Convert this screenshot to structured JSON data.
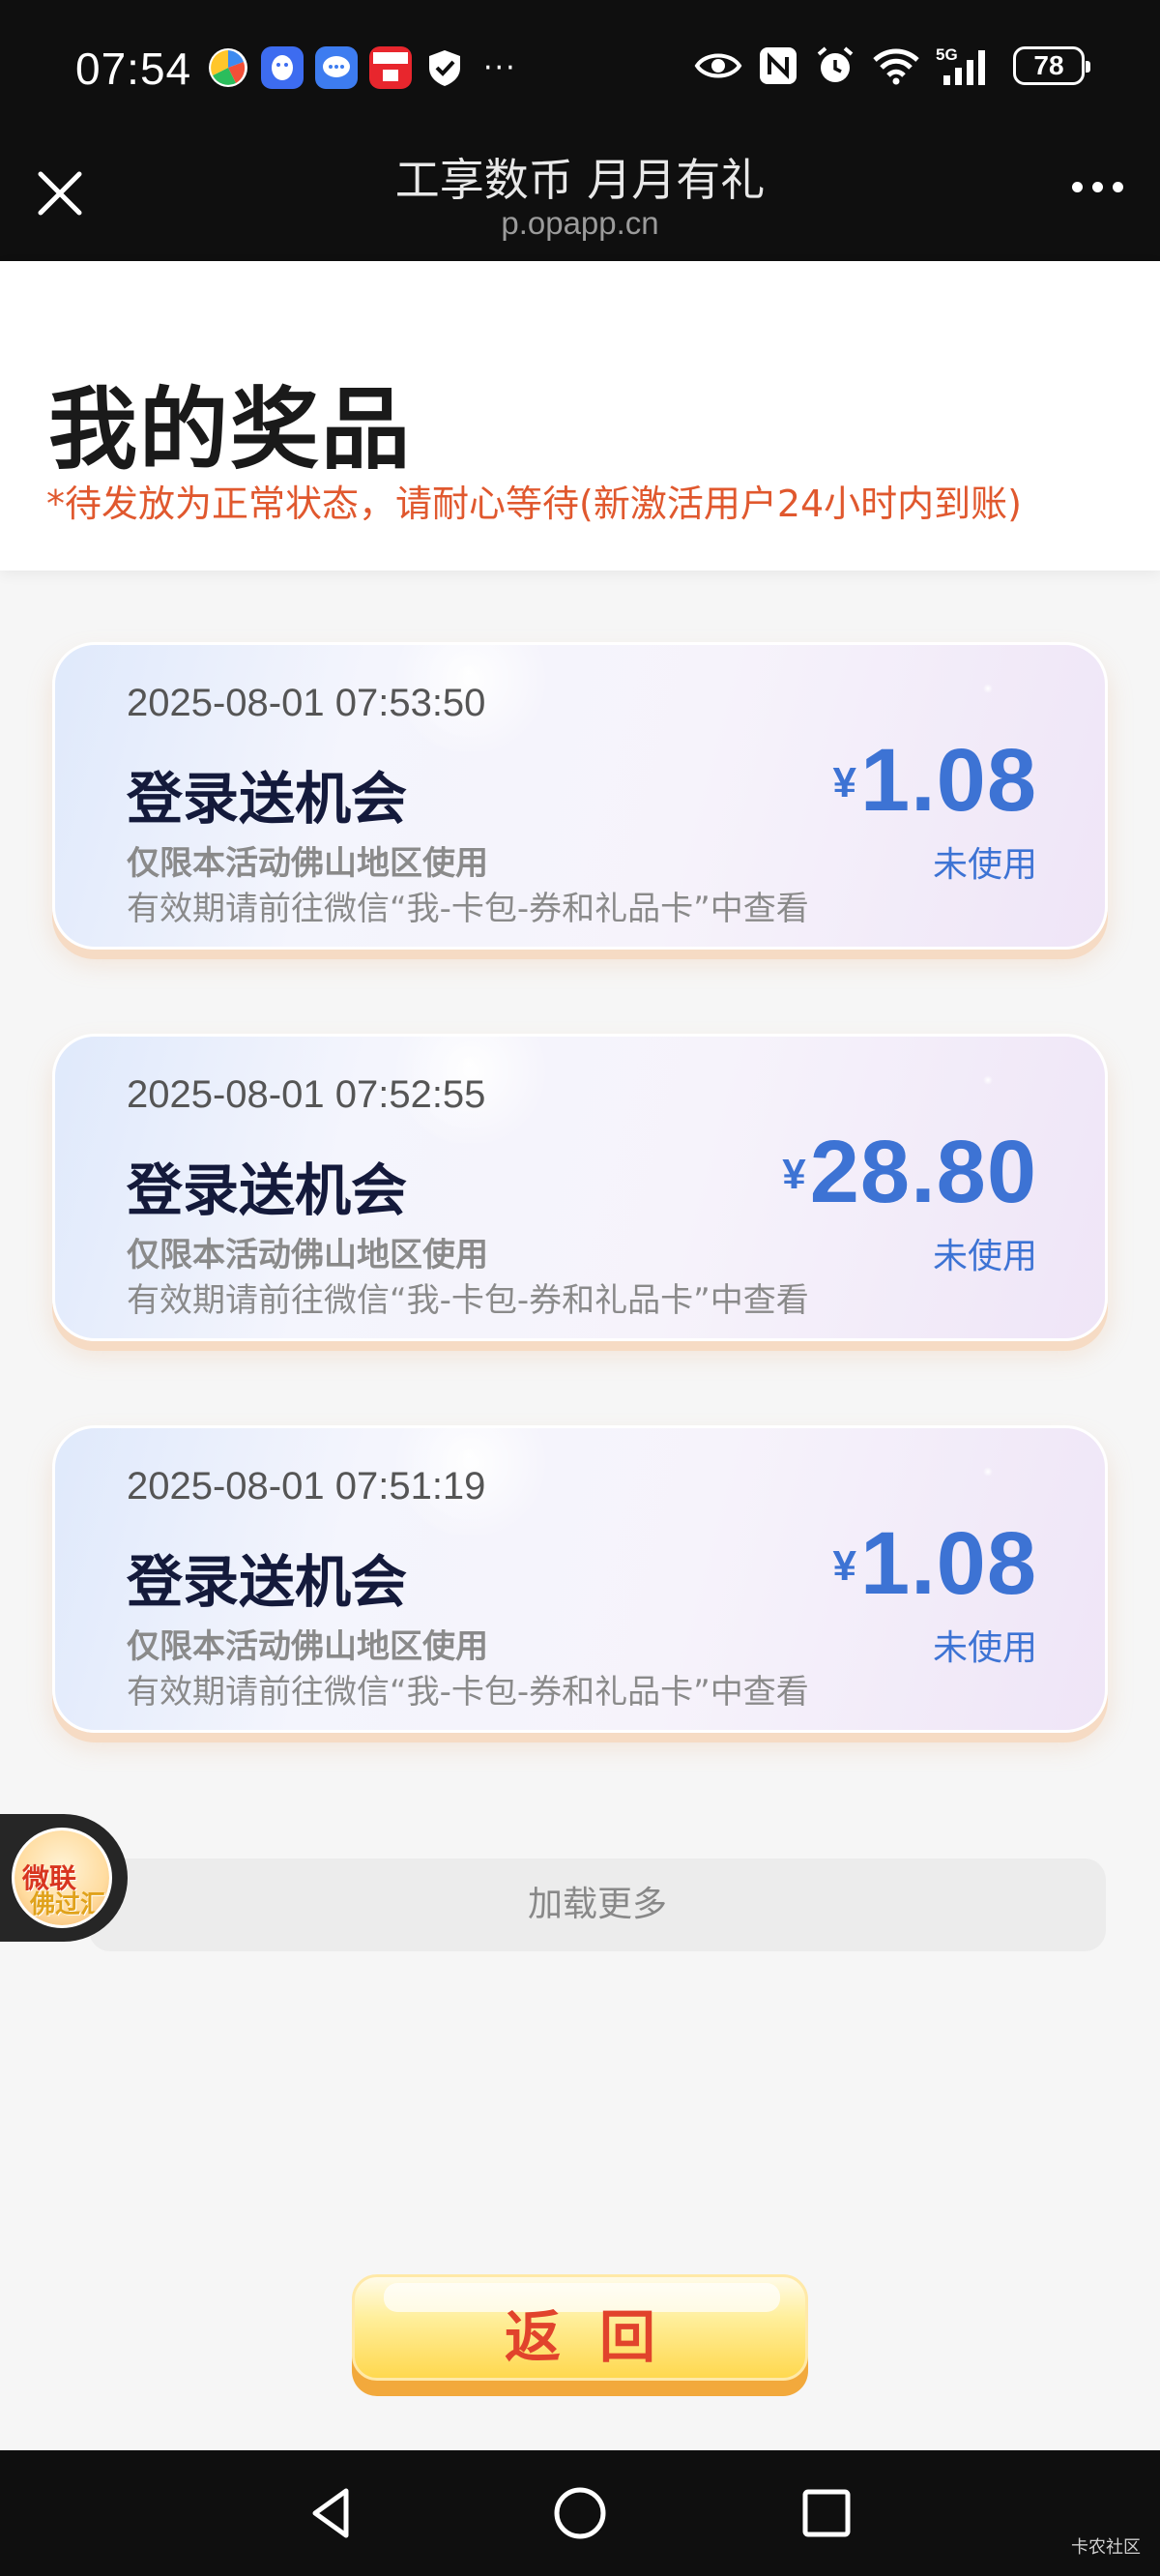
{
  "status_bar": {
    "time": "07:54",
    "app_icons": [
      "pinwheel-app-icon",
      "qq-app-icon",
      "messages-app-icon",
      "yunshanfu-app-icon",
      "shield-app-icon"
    ],
    "more_glyph": "···",
    "battery": "78"
  },
  "nav": {
    "title": "工享数币 月月有礼",
    "url": "p.opapp.cn"
  },
  "header": {
    "title": "我的奖品",
    "tip": "*待发放为正常状态，请耐心等待(新激活用户24小时内到账)"
  },
  "prizes": [
    {
      "time": "2025-08-01 07:53:50",
      "title": "登录送机会",
      "area": "仅限本活动佛山地区使用",
      "expiry": "有效期请前往微信“我-卡包-券和礼品卡”中查看",
      "currency": "¥",
      "amount": "1.08",
      "status": "未使用"
    },
    {
      "time": "2025-08-01 07:52:55",
      "title": "登录送机会",
      "area": "仅限本活动佛山地区使用",
      "expiry": "有效期请前往微信“我-卡包-券和礼品卡”中查看",
      "currency": "¥",
      "amount": "28.80",
      "status": "未使用"
    },
    {
      "time": "2025-08-01 07:51:19",
      "title": "登录送机会",
      "area": "仅限本活动佛山地区使用",
      "expiry": "有效期请前往微信“我-卡包-券和礼品卡”中查看",
      "currency": "¥",
      "amount": "1.08",
      "status": "未使用"
    }
  ],
  "load_more": "加载更多",
  "float_badge": {
    "line1": "微联",
    "line2": "佛过汇"
  },
  "return_button": "返回",
  "watermark": "卡农社区",
  "colors": {
    "accent_blue": "#3d73d4",
    "tip_orange": "#e0582e",
    "button_red_text": "#e1432c",
    "button_yellow": "#ffd84f"
  }
}
